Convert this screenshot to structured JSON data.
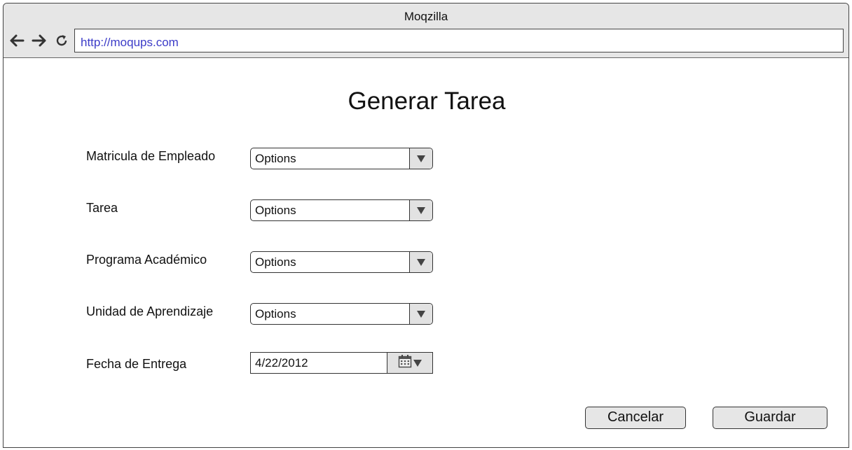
{
  "browser": {
    "title": "Moqzilla",
    "url": "http://moqups.com",
    "icons": [
      "back-arrow-icon",
      "forward-arrow-icon",
      "reload-icon"
    ]
  },
  "page": {
    "title": "Generar Tarea"
  },
  "form": {
    "fields": [
      {
        "label": "Matricula de Empleado",
        "value": "Options"
      },
      {
        "label": "Tarea",
        "value": "Options"
      },
      {
        "label": "Programa Académico",
        "value": "Options"
      },
      {
        "label": "Unidad de Aprendizaje",
        "value": "Options"
      }
    ],
    "date": {
      "label": "Fecha de Entrega",
      "value": "4/22/2012"
    }
  },
  "buttons": {
    "cancel": "Cancelar",
    "save": "Guardar"
  }
}
